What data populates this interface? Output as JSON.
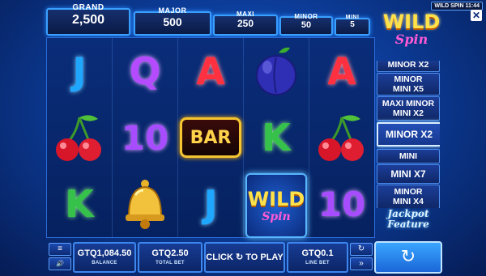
{
  "jackpots": [
    {
      "label": "GRAND",
      "value": "2,500"
    },
    {
      "label": "MAJOR",
      "value": "500"
    },
    {
      "label": "MAXI",
      "value": "250"
    },
    {
      "label": "MINOR",
      "value": "50"
    },
    {
      "label": "MINI",
      "value": "5"
    }
  ],
  "logo": {
    "line1": "WILD",
    "line2": "Spin"
  },
  "top_info": "WILD SPIN 11:44",
  "close_icon": "✕",
  "reels": [
    [
      "J",
      "cherry",
      "K"
    ],
    [
      "Q",
      "10",
      "bell"
    ],
    [
      "A",
      "BAR",
      "J"
    ],
    [
      "plum",
      "K",
      "WILD"
    ],
    [
      "A",
      "cherry",
      "10"
    ]
  ],
  "symbols": {
    "bar": "BAR",
    "wild_1": "WILD",
    "wild_2": "Spin"
  },
  "symbol_colors": {
    "J": "#1fa6ff",
    "Q": "#b44bff",
    "K": "#36c24a",
    "A": "#ff3040",
    "10": "#a74cff"
  },
  "side_list": [
    {
      "lines": [
        "MINOR X2"
      ],
      "highlight": false
    },
    {
      "lines": [
        "MINOR",
        "MINI X5"
      ],
      "highlight": false
    },
    {
      "lines": [
        "MAXI  MINOR",
        "MINI X2"
      ],
      "highlight": false
    },
    {
      "lines": [
        "MINOR X2"
      ],
      "highlight": true
    },
    {
      "lines": [
        "MINI"
      ],
      "highlight": false
    },
    {
      "lines": [
        "MINI X7"
      ],
      "highlight": false
    },
    {
      "lines": [
        "MINOR",
        "MINI X4"
      ],
      "highlight": false
    }
  ],
  "jackpot_feature": [
    "Jackpot",
    "Feature"
  ],
  "bottom": {
    "balance": {
      "value": "GTQ1,084.50",
      "label": "BALANCE"
    },
    "total_bet": {
      "value": "GTQ2.50",
      "label": "TOTAL BET"
    },
    "play": {
      "label": "CLICK ↻ TO PLAY"
    },
    "line_bet": {
      "value": "GTQ0.1",
      "label": "LINE BET"
    }
  },
  "icons": {
    "menu": "≡",
    "sound": "🔊",
    "autoplay": "↻",
    "fast": "»",
    "spin": "↻"
  }
}
